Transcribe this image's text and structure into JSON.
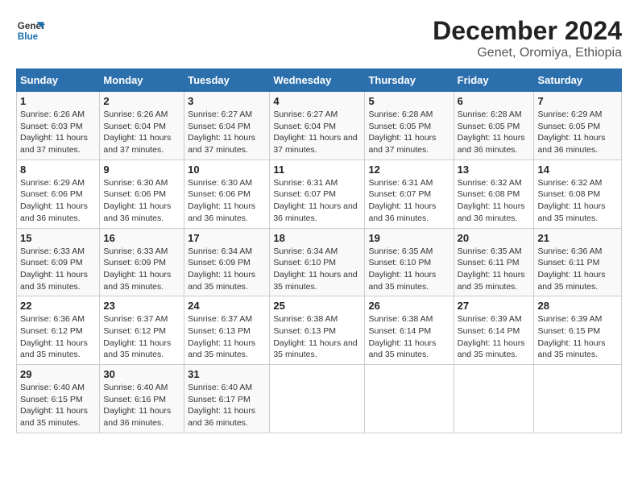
{
  "logo": {
    "line1": "General",
    "line2": "Blue"
  },
  "title": "December 2024",
  "subtitle": "Genet, Oromiya, Ethiopia",
  "days_of_week": [
    "Sunday",
    "Monday",
    "Tuesday",
    "Wednesday",
    "Thursday",
    "Friday",
    "Saturday"
  ],
  "weeks": [
    [
      {
        "day": "1",
        "sunrise": "6:26 AM",
        "sunset": "6:03 PM",
        "daylight": "11 hours and 37 minutes."
      },
      {
        "day": "2",
        "sunrise": "6:26 AM",
        "sunset": "6:04 PM",
        "daylight": "11 hours and 37 minutes."
      },
      {
        "day": "3",
        "sunrise": "6:27 AM",
        "sunset": "6:04 PM",
        "daylight": "11 hours and 37 minutes."
      },
      {
        "day": "4",
        "sunrise": "6:27 AM",
        "sunset": "6:04 PM",
        "daylight": "11 hours and 37 minutes."
      },
      {
        "day": "5",
        "sunrise": "6:28 AM",
        "sunset": "6:05 PM",
        "daylight": "11 hours and 37 minutes."
      },
      {
        "day": "6",
        "sunrise": "6:28 AM",
        "sunset": "6:05 PM",
        "daylight": "11 hours and 36 minutes."
      },
      {
        "day": "7",
        "sunrise": "6:29 AM",
        "sunset": "6:05 PM",
        "daylight": "11 hours and 36 minutes."
      }
    ],
    [
      {
        "day": "8",
        "sunrise": "6:29 AM",
        "sunset": "6:06 PM",
        "daylight": "11 hours and 36 minutes."
      },
      {
        "day": "9",
        "sunrise": "6:30 AM",
        "sunset": "6:06 PM",
        "daylight": "11 hours and 36 minutes."
      },
      {
        "day": "10",
        "sunrise": "6:30 AM",
        "sunset": "6:06 PM",
        "daylight": "11 hours and 36 minutes."
      },
      {
        "day": "11",
        "sunrise": "6:31 AM",
        "sunset": "6:07 PM",
        "daylight": "11 hours and 36 minutes."
      },
      {
        "day": "12",
        "sunrise": "6:31 AM",
        "sunset": "6:07 PM",
        "daylight": "11 hours and 36 minutes."
      },
      {
        "day": "13",
        "sunrise": "6:32 AM",
        "sunset": "6:08 PM",
        "daylight": "11 hours and 36 minutes."
      },
      {
        "day": "14",
        "sunrise": "6:32 AM",
        "sunset": "6:08 PM",
        "daylight": "11 hours and 35 minutes."
      }
    ],
    [
      {
        "day": "15",
        "sunrise": "6:33 AM",
        "sunset": "6:09 PM",
        "daylight": "11 hours and 35 minutes."
      },
      {
        "day": "16",
        "sunrise": "6:33 AM",
        "sunset": "6:09 PM",
        "daylight": "11 hours and 35 minutes."
      },
      {
        "day": "17",
        "sunrise": "6:34 AM",
        "sunset": "6:09 PM",
        "daylight": "11 hours and 35 minutes."
      },
      {
        "day": "18",
        "sunrise": "6:34 AM",
        "sunset": "6:10 PM",
        "daylight": "11 hours and 35 minutes."
      },
      {
        "day": "19",
        "sunrise": "6:35 AM",
        "sunset": "6:10 PM",
        "daylight": "11 hours and 35 minutes."
      },
      {
        "day": "20",
        "sunrise": "6:35 AM",
        "sunset": "6:11 PM",
        "daylight": "11 hours and 35 minutes."
      },
      {
        "day": "21",
        "sunrise": "6:36 AM",
        "sunset": "6:11 PM",
        "daylight": "11 hours and 35 minutes."
      }
    ],
    [
      {
        "day": "22",
        "sunrise": "6:36 AM",
        "sunset": "6:12 PM",
        "daylight": "11 hours and 35 minutes."
      },
      {
        "day": "23",
        "sunrise": "6:37 AM",
        "sunset": "6:12 PM",
        "daylight": "11 hours and 35 minutes."
      },
      {
        "day": "24",
        "sunrise": "6:37 AM",
        "sunset": "6:13 PM",
        "daylight": "11 hours and 35 minutes."
      },
      {
        "day": "25",
        "sunrise": "6:38 AM",
        "sunset": "6:13 PM",
        "daylight": "11 hours and 35 minutes."
      },
      {
        "day": "26",
        "sunrise": "6:38 AM",
        "sunset": "6:14 PM",
        "daylight": "11 hours and 35 minutes."
      },
      {
        "day": "27",
        "sunrise": "6:39 AM",
        "sunset": "6:14 PM",
        "daylight": "11 hours and 35 minutes."
      },
      {
        "day": "28",
        "sunrise": "6:39 AM",
        "sunset": "6:15 PM",
        "daylight": "11 hours and 35 minutes."
      }
    ],
    [
      {
        "day": "29",
        "sunrise": "6:40 AM",
        "sunset": "6:15 PM",
        "daylight": "11 hours and 35 minutes."
      },
      {
        "day": "30",
        "sunrise": "6:40 AM",
        "sunset": "6:16 PM",
        "daylight": "11 hours and 36 minutes."
      },
      {
        "day": "31",
        "sunrise": "6:40 AM",
        "sunset": "6:17 PM",
        "daylight": "11 hours and 36 minutes."
      },
      null,
      null,
      null,
      null
    ]
  ],
  "cell_labels": {
    "sunrise": "Sunrise: ",
    "sunset": "Sunset: ",
    "daylight": "Daylight: "
  }
}
